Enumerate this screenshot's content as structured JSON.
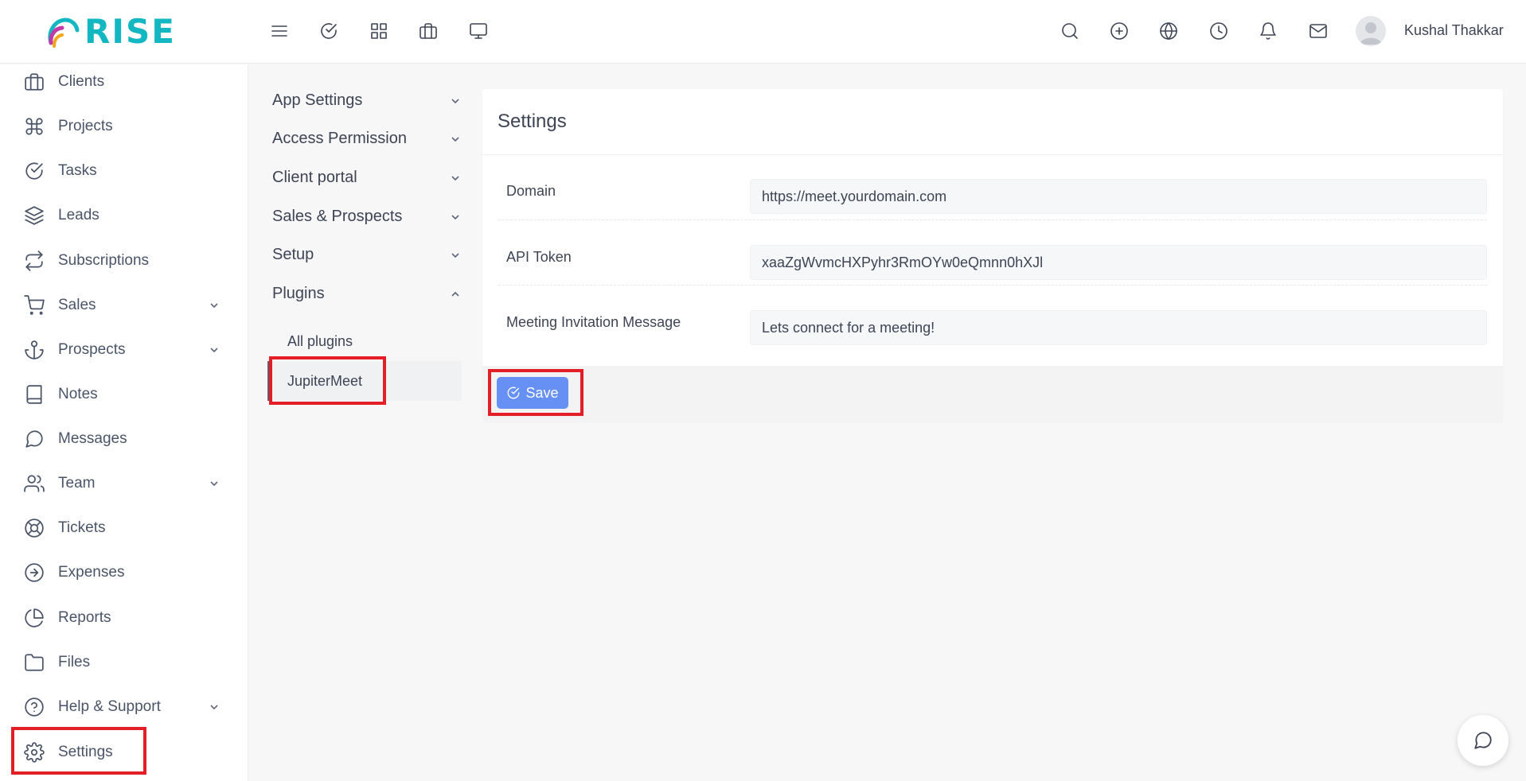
{
  "brand": {
    "name": "RISE",
    "accent_color": "#12b7c1"
  },
  "topbar": {
    "left_icons": [
      "menu-icon",
      "check-circle-icon",
      "grid-icon",
      "briefcase-icon",
      "monitor-icon"
    ],
    "right_icons": [
      "search-icon",
      "plus-circle-icon",
      "globe-icon",
      "clock-icon",
      "bell-icon",
      "mail-icon"
    ],
    "user_name": "Kushal Thakkar"
  },
  "sidebar": {
    "items": [
      {
        "label": "Clients",
        "icon": "briefcase-icon",
        "has_submenu": false
      },
      {
        "label": "Projects",
        "icon": "command-icon",
        "has_submenu": false
      },
      {
        "label": "Tasks",
        "icon": "check-circle-icon",
        "has_submenu": false
      },
      {
        "label": "Leads",
        "icon": "layers-icon",
        "has_submenu": false
      },
      {
        "label": "Subscriptions",
        "icon": "repeat-icon",
        "has_submenu": false
      },
      {
        "label": "Sales",
        "icon": "cart-icon",
        "has_submenu": true
      },
      {
        "label": "Prospects",
        "icon": "anchor-icon",
        "has_submenu": true
      },
      {
        "label": "Notes",
        "icon": "book-icon",
        "has_submenu": false
      },
      {
        "label": "Messages",
        "icon": "message-circle-icon",
        "has_submenu": false
      },
      {
        "label": "Team",
        "icon": "users-icon",
        "has_submenu": true
      },
      {
        "label": "Tickets",
        "icon": "life-buoy-icon",
        "has_submenu": false
      },
      {
        "label": "Expenses",
        "icon": "arrow-right-circle-icon",
        "has_submenu": false
      },
      {
        "label": "Reports",
        "icon": "pie-chart-icon",
        "has_submenu": false
      },
      {
        "label": "Files",
        "icon": "folder-icon",
        "has_submenu": false
      },
      {
        "label": "Help & Support",
        "icon": "help-circle-icon",
        "has_submenu": true
      },
      {
        "label": "Settings",
        "icon": "gear-icon",
        "has_submenu": false,
        "highlighted": true
      }
    ]
  },
  "settings_menu": {
    "items": [
      {
        "label": "App Settings",
        "expanded": false
      },
      {
        "label": "Access Permission",
        "expanded": false
      },
      {
        "label": "Client portal",
        "expanded": false
      },
      {
        "label": "Sales & Prospects",
        "expanded": false
      },
      {
        "label": "Setup",
        "expanded": false
      },
      {
        "label": "Plugins",
        "expanded": true
      }
    ],
    "plugins_children": [
      {
        "label": "All plugins",
        "active": false
      },
      {
        "label": "JupiterMeet",
        "active": true,
        "highlighted": true
      }
    ]
  },
  "settings_card": {
    "title": "Settings",
    "fields": [
      {
        "label": "Domain",
        "value": "https://meet.yourdomain.com"
      },
      {
        "label": "API Token",
        "value": "xaaZgWvmcHXPyhr3RmOYw0eQmnn0hXJl"
      },
      {
        "label": "Meeting Invitation Message",
        "value": "Lets connect for a meeting!"
      }
    ],
    "save_label": "Save",
    "save_color": "#6690f4"
  },
  "highlight_color": "#e41e26"
}
